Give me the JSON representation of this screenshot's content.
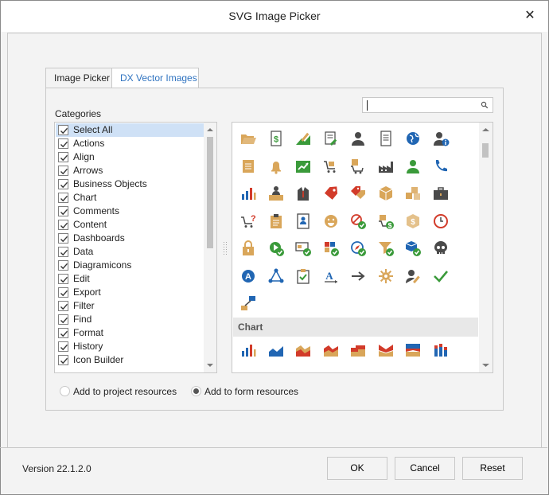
{
  "window": {
    "title": "SVG Image Picker",
    "close_glyph": "✕"
  },
  "tabs": [
    {
      "label": "Image Picker",
      "active": false
    },
    {
      "label": "DX Vector Images",
      "active": true
    }
  ],
  "categories": {
    "label": "Categories",
    "items": [
      {
        "label": "Select All",
        "checked": true,
        "selected": true
      },
      {
        "label": "Actions",
        "checked": true
      },
      {
        "label": "Align",
        "checked": true
      },
      {
        "label": "Arrows",
        "checked": true
      },
      {
        "label": "Business Objects",
        "checked": true
      },
      {
        "label": "Chart",
        "checked": true
      },
      {
        "label": "Comments",
        "checked": true
      },
      {
        "label": "Content",
        "checked": true
      },
      {
        "label": "Dashboards",
        "checked": true
      },
      {
        "label": "Data",
        "checked": true
      },
      {
        "label": "Diagramicons",
        "checked": true
      },
      {
        "label": "Edit",
        "checked": true
      },
      {
        "label": "Export",
        "checked": true
      },
      {
        "label": "Filter",
        "checked": true
      },
      {
        "label": "Find",
        "checked": true
      },
      {
        "label": "Format",
        "checked": true
      },
      {
        "label": "History",
        "checked": true
      },
      {
        "label": "Icon Builder",
        "checked": true
      }
    ]
  },
  "search": {
    "value": "",
    "placeholder": ""
  },
  "icon_gallery": {
    "group_header": "Chart",
    "colors": {
      "gold": "#d9a65a",
      "green": "#3a9a3a",
      "blue": "#2166b3",
      "red": "#d23b2a",
      "dark": "#4a4a4a"
    },
    "rows": [
      [
        "folder-open-icon",
        "dollar-document-icon",
        "edit-chart-icon",
        "edit-document-icon",
        "user-icon",
        "document-icon",
        "globe-icon",
        "user-info-icon"
      ],
      [
        "note-icon",
        "bell-icon",
        "trend-chart-icon",
        "cart-icon",
        "shopping-cart-icon",
        "factory-icon",
        "employee-icon",
        "phone-icon"
      ],
      [
        "bar-chart-icon",
        "reception-icon",
        "suit-icon",
        "tag-icon",
        "price-tag-icon",
        "package-icon",
        "packages-icon",
        "briefcase-icon"
      ],
      [
        "cart-question-icon",
        "clipboard-icon",
        "contact-card-icon",
        "smile-icon",
        "cancel-check-icon",
        "dollar-cart-icon",
        "dollar-box-icon",
        "clock-icon"
      ],
      [
        "lock-icon",
        "play-check-icon",
        "card-check-icon",
        "grid-check-icon",
        "compass-check-icon",
        "filter-check-icon",
        "cube-check-icon",
        "skull-icon"
      ],
      [
        "address-icon",
        "network-icon",
        "task-clipboard-icon",
        "text-format-icon",
        "arrow-right-icon",
        "settings-icon",
        "user-edit-icon",
        "check-icon",
        "truck-icon"
      ],
      [
        "flow-icon"
      ]
    ],
    "chart_row": [
      "bar-chart-icon",
      "area-chart-icon",
      "stacked-area-icon",
      "line-area-icon",
      "step-area-icon",
      "bow-area-icon",
      "range-area-icon",
      "stacked-bar-icon"
    ]
  },
  "resources": [
    {
      "label": "Add to project resources",
      "checked": false
    },
    {
      "label": "Add to form resources",
      "checked": true
    }
  ],
  "footer": {
    "version": "Version 22.1.2.0",
    "ok_label": "OK",
    "cancel_label": "Cancel",
    "reset_label": "Reset"
  }
}
